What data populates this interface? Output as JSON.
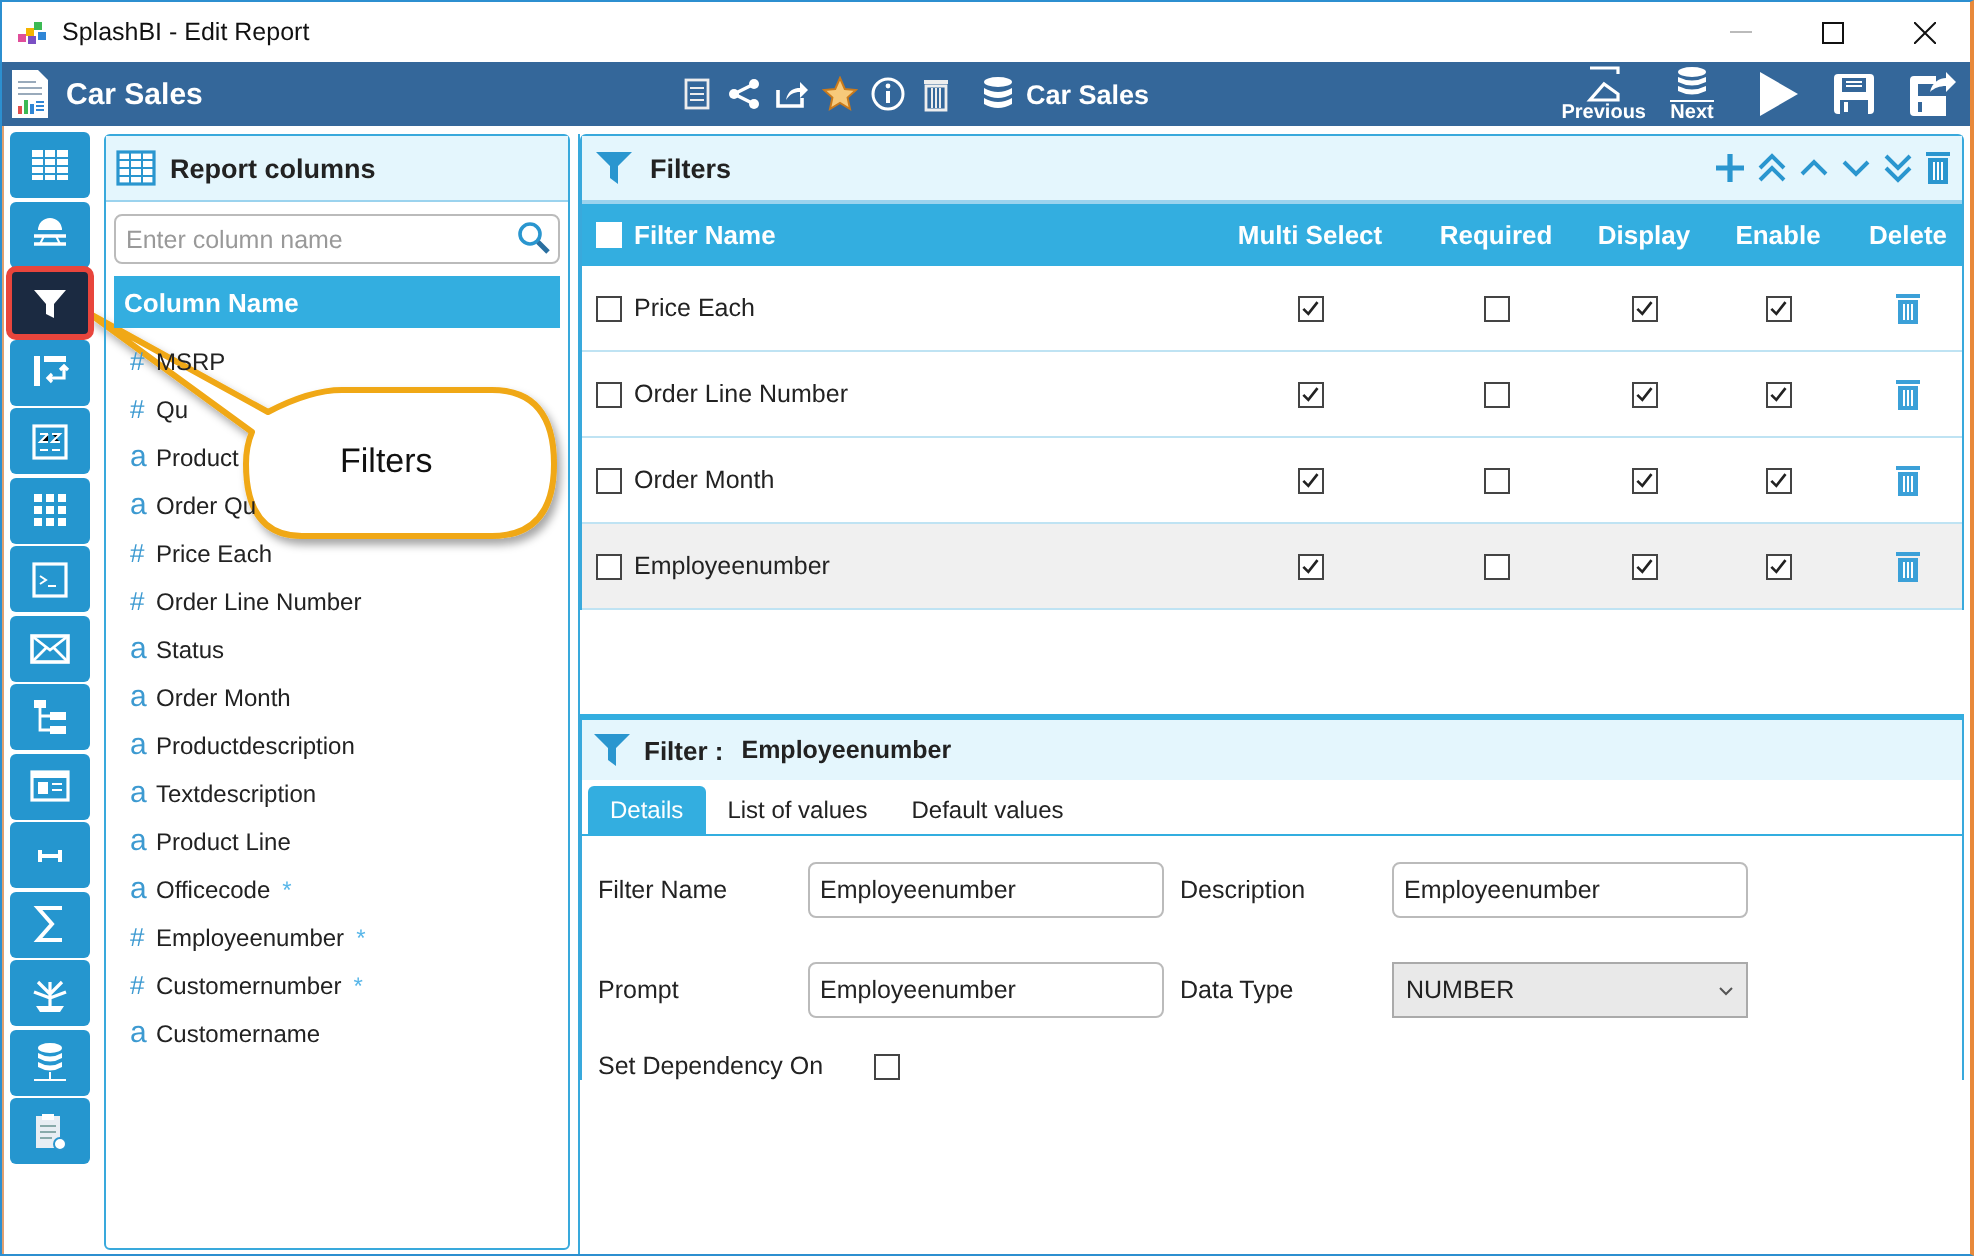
{
  "window": {
    "title": "SplashBI - Edit Report"
  },
  "header": {
    "title": "Car Sales",
    "datasource": "Car Sales",
    "nav": [
      {
        "label": "Previous"
      },
      {
        "label": "Next"
      }
    ]
  },
  "rail": [
    {
      "selected": false
    },
    {
      "selected": false
    },
    {
      "selected": true
    },
    {
      "selected": false
    },
    {
      "selected": false
    },
    {
      "selected": false
    },
    {
      "selected": false
    },
    {
      "selected": false
    },
    {
      "selected": false
    },
    {
      "selected": false
    },
    {
      "selected": false
    },
    {
      "selected": false
    },
    {
      "selected": false
    },
    {
      "selected": false
    },
    {
      "selected": false
    }
  ],
  "columns_panel": {
    "title": "Report columns",
    "search": {
      "placeholder": "Enter column name"
    },
    "header": "Column Name",
    "items": [
      {
        "glyph": "#",
        "name": "MSRP"
      },
      {
        "glyph": "#",
        "name": "Qu"
      },
      {
        "glyph": "a",
        "name": "Product"
      },
      {
        "glyph": "a",
        "name": "Order Qu"
      },
      {
        "glyph": "#",
        "name": "Price Each"
      },
      {
        "glyph": "#",
        "name": "Order Line Number"
      },
      {
        "glyph": "a",
        "name": "Status"
      },
      {
        "glyph": "a",
        "name": "Order Month"
      },
      {
        "glyph": "a",
        "name": "Productdescription"
      },
      {
        "glyph": "a",
        "name": "Textdescription"
      },
      {
        "glyph": "a",
        "name": "Product Line"
      },
      {
        "glyph": "a",
        "name": "Officecode",
        "mark": "*"
      },
      {
        "glyph": "#",
        "name": "Employeenumber",
        "mark": "*"
      },
      {
        "glyph": "#",
        "name": "Customernumber",
        "mark": "*"
      },
      {
        "glyph": "a",
        "name": "Customername"
      }
    ]
  },
  "callout": {
    "text": "Filters"
  },
  "filters": {
    "title": "Filters",
    "columns": [
      "Filter Name",
      "Multi Select",
      "Required",
      "Display",
      "Enable",
      "Delete"
    ],
    "all_checked": false,
    "rows": [
      {
        "name": "Price Each",
        "checked": false,
        "multi_select": true,
        "required": false,
        "display": true,
        "enable": true,
        "selected": false
      },
      {
        "name": "Order Line Number",
        "checked": false,
        "multi_select": true,
        "required": false,
        "display": true,
        "enable": true,
        "selected": false
      },
      {
        "name": "Order Month",
        "checked": false,
        "multi_select": true,
        "required": false,
        "display": true,
        "enable": true,
        "selected": false
      },
      {
        "name": "Employeenumber",
        "checked": false,
        "multi_select": true,
        "required": false,
        "display": true,
        "enable": true,
        "selected": true
      }
    ]
  },
  "filter_detail": {
    "title": "Filter :",
    "name": "Employeenumber",
    "tabs": [
      {
        "label": "Details",
        "selected": true
      },
      {
        "label": "List of values",
        "selected": false
      },
      {
        "label": "Default values",
        "selected": false
      }
    ],
    "fields": [
      {
        "label": "Filter Name",
        "kind": "text",
        "value": "Employeenumber"
      },
      {
        "label": "Description",
        "kind": "text",
        "value": "Employeenumber"
      },
      {
        "label": "Prompt",
        "kind": "text",
        "value": "Employeenumber"
      },
      {
        "label": "Data Type",
        "kind": "select",
        "value": "NUMBER"
      }
    ],
    "dependency": {
      "label": "Set Dependency On",
      "checked": false
    }
  }
}
